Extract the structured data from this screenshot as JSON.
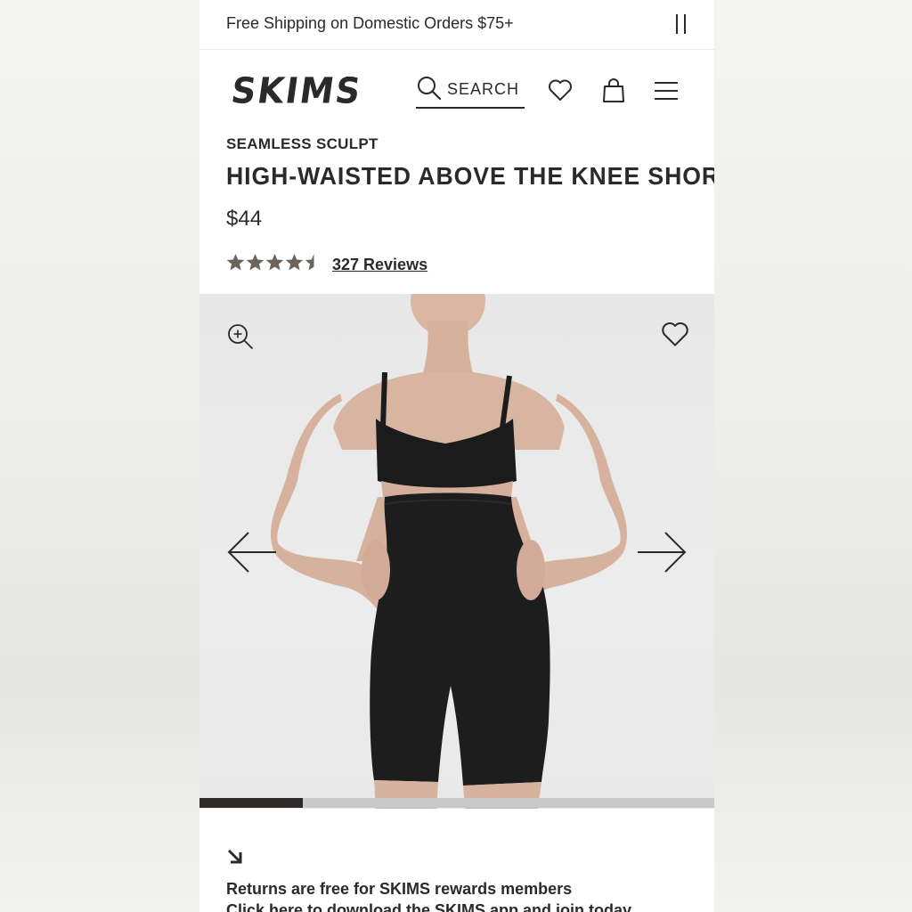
{
  "promo": {
    "text": "Free Shipping on Domestic Orders $75+",
    "pause_icon": "pause-icon"
  },
  "header": {
    "logo": "SKIMS",
    "search_label": "SEARCH",
    "icons": [
      "search-icon",
      "heart-icon",
      "bag-icon",
      "menu-icon"
    ]
  },
  "product": {
    "collection": "SEAMLESS SCULPT",
    "title": "HIGH-WAISTED ABOVE THE KNEE SHORT",
    "price": "$44",
    "rating": 4.5,
    "rating_max": 5,
    "reviews_label": "327 Reviews"
  },
  "gallery": {
    "icons": [
      "zoom-in-icon",
      "heart-icon",
      "arrow-left-icon",
      "arrow-right-icon"
    ],
    "progress": 0.2
  },
  "returns": {
    "icon": "arrow-down-right-icon",
    "line1": "Returns are free for SKIMS rewards members",
    "line2": "Click here to download the SKIMS app and join today"
  },
  "colors": {
    "text": "#2b2a28",
    "star": "#6b645c",
    "image_bg": "#e9e9e9",
    "progress_track": "#c9c9c9"
  }
}
